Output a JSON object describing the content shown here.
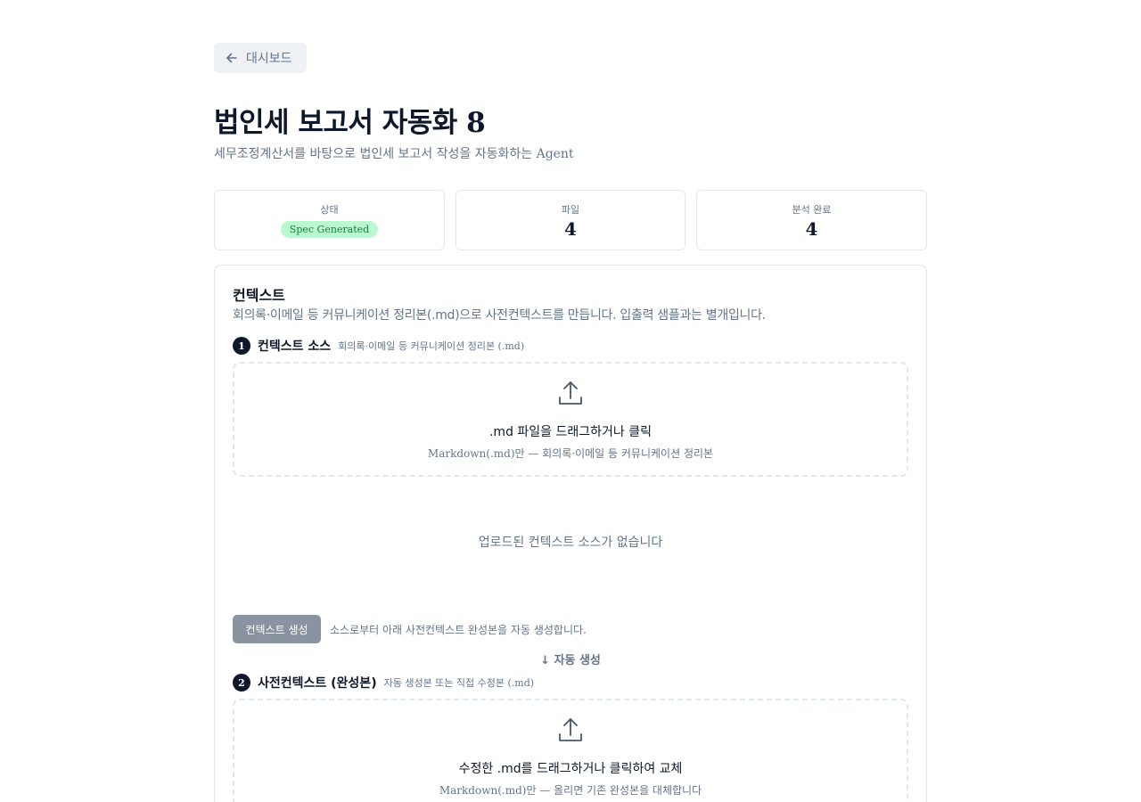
{
  "back": {
    "label": "대시보드",
    "icon": "arrow-left-icon"
  },
  "header": {
    "title": "법인세 보고서 자동화",
    "title_number": "8",
    "subtitle": "세무조정계산서를 바탕으로 법인세 보고서 작성을 자동화하는 Agent"
  },
  "stats": {
    "status": {
      "label": "상태",
      "badge": "Spec Generated",
      "badge_color": "#bbf7d0"
    },
    "files": {
      "label": "파일",
      "value": "4"
    },
    "analyzed": {
      "label": "분석 완료",
      "value": "4"
    }
  },
  "context": {
    "title": "컨텍스트",
    "description": "회의록·이메일 등 커뮤니케이션 정리본(.md)으로 사전컨텍스트를 만듭니다. 입출력 샘플과는 별개입니다.",
    "step1": {
      "number": "1",
      "title": "컨텍스트 소스",
      "hint": "회의록·이메일 등 커뮤니케이션 정리본 (.md)",
      "dropzone_main": ".md 파일을 드래그하거나 클릭",
      "dropzone_sub": "Markdown(.md)만 — 회의록·이메일 등 커뮤니케이션 정리본",
      "empty": "업로드된 컨텍스트 소스가 없습니다"
    },
    "generate": {
      "button": "컨텍스트 생성",
      "hint": "소스로부터 아래 사전컨텍스트 완성본을 자동 생성합니다."
    },
    "auto_label": "↓ 자동 생성",
    "step2": {
      "number": "2",
      "title": "사전컨텍스트 (완성본)",
      "hint": "자동 생성본 또는 직접 수정본 (.md)",
      "dropzone_main": "수정한 .md를 드래그하거나 클릭하여 교체",
      "dropzone_sub": "Markdown(.md)만 — 올리면 기존 완성본을 대체합니다"
    }
  }
}
